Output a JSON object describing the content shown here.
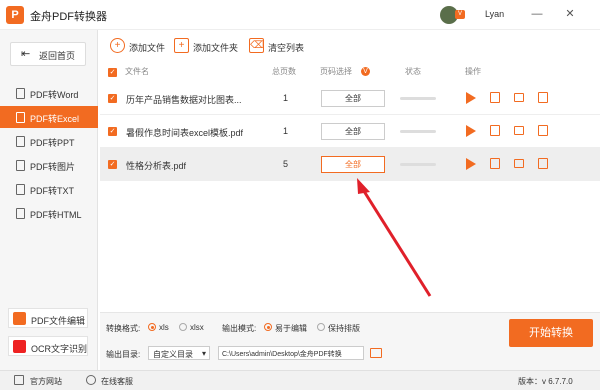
{
  "titlebar": {
    "logo_letter": "P",
    "title": "金舟PDF转换器",
    "username": "Lyan",
    "badge": "V"
  },
  "sidebar": {
    "back_label": "返回首页",
    "items": [
      {
        "label": "PDF转Word"
      },
      {
        "label": "PDF转Excel"
      },
      {
        "label": "PDF转PPT"
      },
      {
        "label": "PDF转图片"
      },
      {
        "label": "PDF转TXT"
      },
      {
        "label": "PDF转HTML"
      }
    ],
    "active": "PDF转Excel",
    "pdf_editor": "PDF文件编辑",
    "ocr": "OCR文字识别"
  },
  "toolbar": {
    "add_file": "添加文件",
    "add_folder": "添加文件夹",
    "clear_list": "清空列表"
  },
  "table": {
    "headers": {
      "name": "文件名",
      "pages": "总页数",
      "page_select": "页码选择",
      "status": "状态",
      "actions": "操作"
    },
    "rows": [
      {
        "name": "历年产品销售数据对比图表...",
        "pages": "1",
        "page_btn": "全部"
      },
      {
        "name": "暑假作息时间表excel模板.pdf",
        "pages": "1",
        "page_btn": "全部"
      },
      {
        "name": "性格分析表.pdf",
        "pages": "5",
        "page_btn": "全部"
      }
    ]
  },
  "footer": {
    "format_label": "转换格式:",
    "fmt_xls": "xls",
    "fmt_xlsx": "xlsx",
    "mode_label": "输出模式:",
    "mode_easy": "易于编辑",
    "mode_keep": "保持排版",
    "dir_label": "输出目录:",
    "dir_select": "自定义目录",
    "path": "C:\\Users\\admin\\Desktop\\金舟PDF转换",
    "start": "开始转换"
  },
  "statusbar": {
    "site": "官方网站",
    "support": "在线客服",
    "version": "版本：v 6.7.7.0"
  },
  "colors": {
    "accent": "#f26b21"
  }
}
